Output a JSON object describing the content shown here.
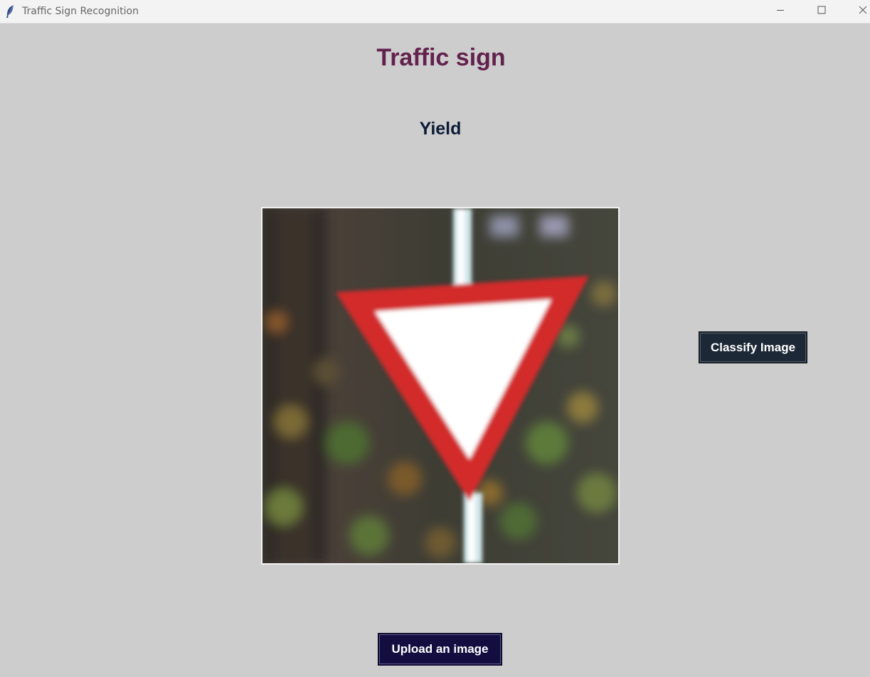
{
  "window": {
    "title": "Traffic Sign Recognition",
    "controls": {
      "minimize": "minimize-icon",
      "maximize": "maximize-icon",
      "close": "close-icon"
    },
    "app_icon": "feather-icon"
  },
  "main": {
    "heading": "Traffic sign",
    "prediction": "Yield",
    "classify_button_label": "Classify Image",
    "upload_button_label": "Upload an image"
  },
  "colors": {
    "background": "#cdcdcd",
    "heading": "#63214e",
    "prediction": "#0d1b37",
    "classify_button": "#1c2835",
    "upload_button": "#140e40",
    "sign_red": "#d32a2a"
  }
}
